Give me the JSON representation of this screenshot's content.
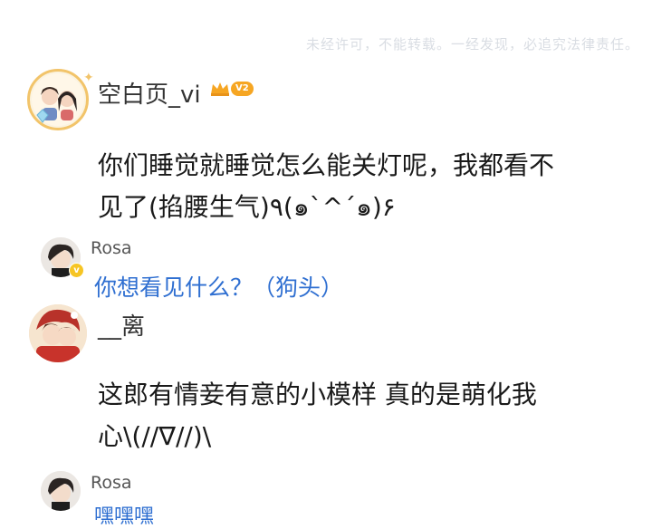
{
  "watermark": "未经许可，不能转载。一经发现，必追究法律责任。",
  "comments": [
    {
      "username": "空白页_vi",
      "level": "V2",
      "text_line1": "你们睡觉就睡觉怎么能关灯呢，我都看不",
      "text_line2": "见了(掐腰生气)٩(๑`^´๑)۶",
      "reply": {
        "username": "Rosa",
        "text": "你想看见什么？（狗头）"
      }
    },
    {
      "username": "__离",
      "text_line1": "这郎有情妾有意的小模样  真的是萌化我",
      "text_line2": "心\\(//∇//)\\",
      "reply": {
        "username": "Rosa",
        "text": "嘿嘿嘿"
      }
    }
  ],
  "colors": {
    "reply_blue": "#2f6fd1",
    "crown_gold": "#f6a623",
    "watermark": "#d9dde3"
  }
}
